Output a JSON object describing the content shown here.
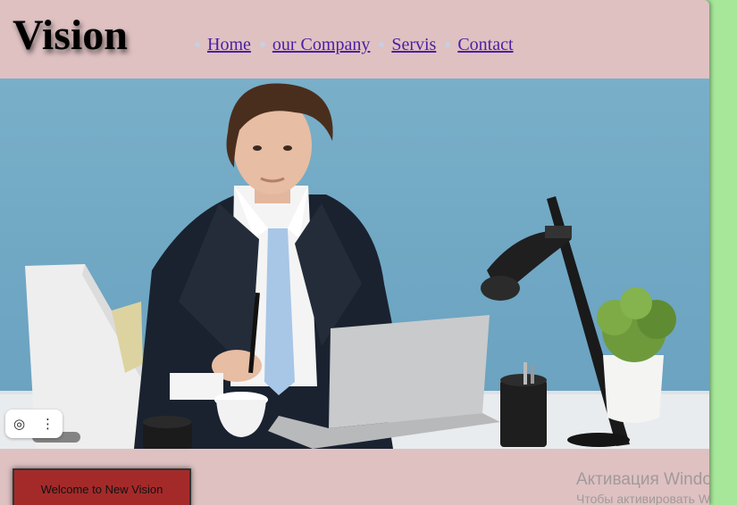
{
  "header": {
    "logo": "Vision",
    "nav": [
      "Home",
      "our Company",
      "Servis",
      "Contact"
    ]
  },
  "hero": {
    "description": "Man in suit at desk with laptop, lamp and plant"
  },
  "toolbar": {
    "icons": [
      "camera-icon",
      "more-vertical-icon"
    ]
  },
  "cta": {
    "welcome_label": "Welcome to New Vision"
  },
  "overlay": {
    "activation_title": "Активация Windows",
    "activation_subtitle": "Чтобы активировать Windows"
  },
  "colors": {
    "page_bg": "#dfc1c2",
    "side_bg": "#a6e79a",
    "hero_sky": "#79afc8",
    "button_bg": "#a42a2a",
    "link": "#4b1fa3"
  }
}
